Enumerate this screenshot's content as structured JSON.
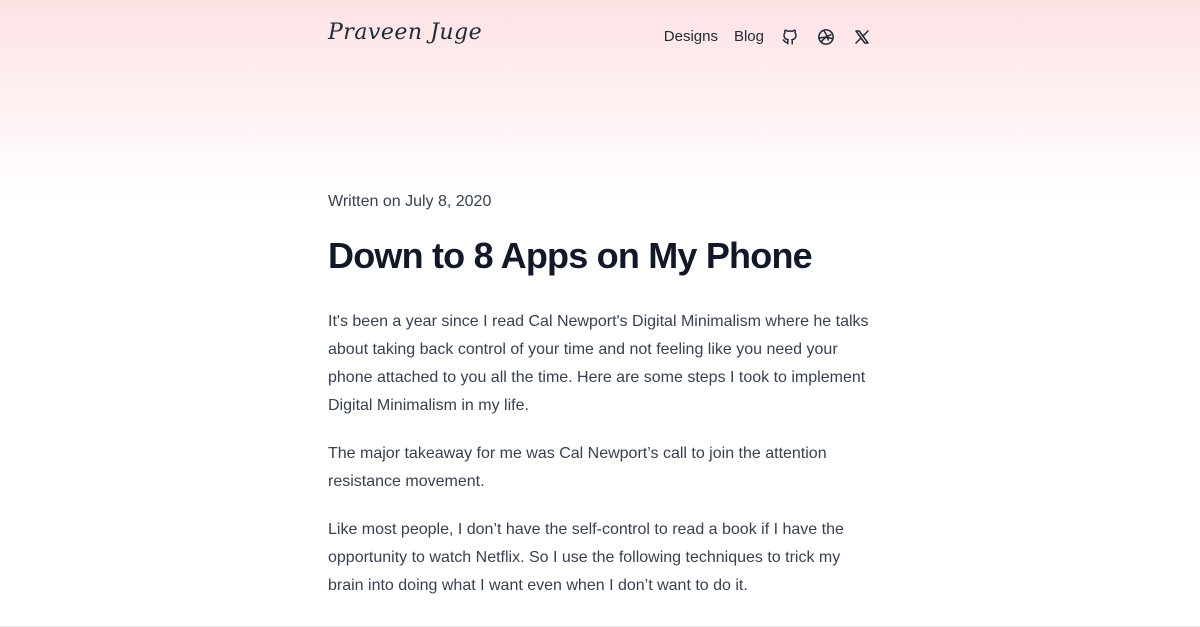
{
  "header": {
    "logo_text": "Praveen Juge",
    "nav": {
      "designs_label": "Designs",
      "blog_label": "Blog",
      "icons": [
        "github-icon",
        "dribbble-icon",
        "x-icon"
      ]
    }
  },
  "post": {
    "meta": "Written on July 8, 2020",
    "title": "Down to 8 Apps on My Phone",
    "paragraphs": [
      "It's been a year since I read Cal Newport's Digital Minimalism where he talks about taking back control of your time and not feeling like you need your phone attached to you all the time. Here are some steps I took to implement Digital Minimalism in my life.",
      "The major takeaway for me was Cal Newport’s call to join the attention resistance movement.",
      "Like most people, I don’t have the self-control to read a book if I have the opportunity to watch Netflix. So I use the following techniques to trick my brain into doing what I want even when I don’t want to do it."
    ]
  },
  "colors": {
    "header_gradient_top": "#fde2e4",
    "text_primary": "#111827",
    "text_body": "#374151"
  }
}
